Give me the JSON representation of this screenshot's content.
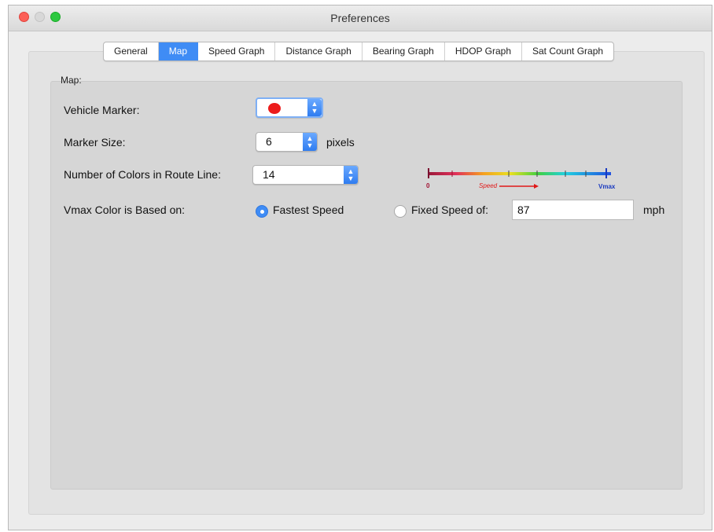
{
  "window": {
    "title": "Preferences"
  },
  "tabs": [
    {
      "label": "General",
      "active": false
    },
    {
      "label": "Map",
      "active": true
    },
    {
      "label": "Speed Graph",
      "active": false
    },
    {
      "label": "Distance Graph",
      "active": false
    },
    {
      "label": "Bearing Graph",
      "active": false
    },
    {
      "label": "HDOP Graph",
      "active": false
    },
    {
      "label": "Sat Count Graph",
      "active": false
    }
  ],
  "map_group": {
    "label": "Map:",
    "vehicle_marker": {
      "label": "Vehicle Marker:",
      "color": "#ec1c1c"
    },
    "marker_size": {
      "label": "Marker Size:",
      "value": "6",
      "unit": "pixels"
    },
    "route_colors": {
      "label": "Number of Colors in Route Line:",
      "value": "14"
    },
    "color_scale": {
      "min_label": "0",
      "speed_label": "Speed",
      "max_label": "Vmax"
    },
    "vmax": {
      "label": "Vmax Color is Based on:",
      "option_fastest": "Fastest Speed",
      "option_fixed": "Fixed Speed of:",
      "selected": "Fastest Speed",
      "fixed_value": "87",
      "unit": "mph"
    }
  },
  "colors": {
    "accent": "#3f8cf5",
    "marker": "#ec1c1c"
  }
}
